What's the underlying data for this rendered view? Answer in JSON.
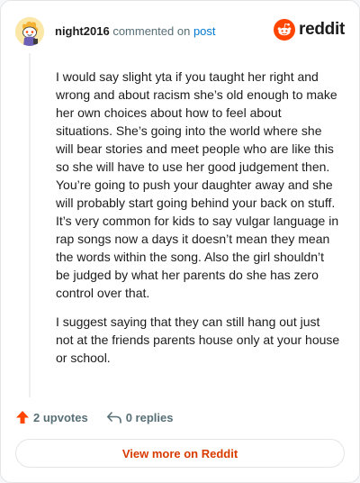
{
  "comment": {
    "username": "night2016",
    "action_text": "commented on",
    "target_link": "post",
    "brand": "reddit",
    "paragraphs": [
      "I would say slight yta if you taught her right and wrong and about racism she’s old enough to make her own choices about how to feel about situations. She’s going into the world where she will bear stories and meet people who are like this so she will have to use her good judgement then. You’re going to push your daughter away and she will probably start going behind your back on stuff. It’s very common for kids to say vulgar language in rap songs now a days it doesn’t mean they mean the words within the song. Also the girl shouldn’t be judged by what her parents do she has zero control over that.",
      "I suggest saying that they can still hang out just not at the friends parents house only at your house or school."
    ]
  },
  "actions": {
    "upvotes_label": "2 upvotes",
    "replies_label": "0 replies"
  },
  "footer": {
    "view_more_label": "View more on Reddit"
  },
  "icons": {
    "avatar": "snoo-avatar",
    "brand": "reddit-logo-icon",
    "upvote": "upvote-arrow-icon",
    "reply": "reply-arrow-icon"
  },
  "colors": {
    "accent": "#ff4500",
    "link": "#0079d3",
    "view_more": "#d93a00",
    "muted": "#576f76"
  }
}
